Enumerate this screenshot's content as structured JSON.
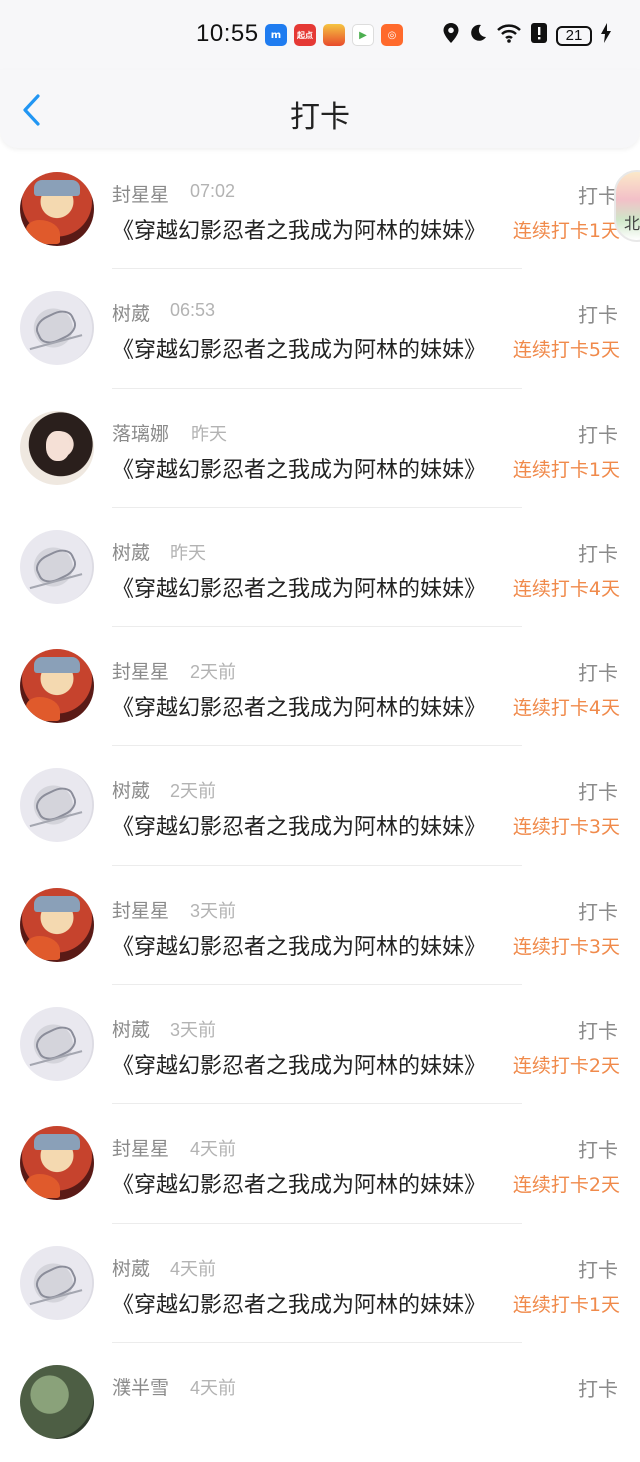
{
  "status_bar": {
    "time": "10:55",
    "apps": [
      {
        "label": "m",
        "color": "#1f7cf0"
      },
      {
        "label": "起点",
        "color": "#e53935"
      },
      {
        "label": "",
        "color": "#f29a1f"
      },
      {
        "label": "",
        "color": "#4caf50"
      },
      {
        "label": "",
        "color": "#ff6a2c"
      }
    ],
    "battery": "21"
  },
  "header": {
    "title": "打卡"
  },
  "edge_badge": {
    "text": "北"
  },
  "list": [
    {
      "name": "封星星",
      "time": "07:02",
      "tag": "打卡",
      "book": "《穿越幻影忍者之我成为阿林的妹妹》",
      "streak": "连续打卡1天",
      "avatar": "naruto"
    },
    {
      "name": "树葳",
      "time": "06:53",
      "tag": "打卡",
      "book": "《穿越幻影忍者之我成为阿林的妹妹》",
      "streak": "连续打卡5天",
      "avatar": "sketch"
    },
    {
      "name": "落璃娜",
      "time": "昨天",
      "tag": "打卡",
      "book": "《穿越幻影忍者之我成为阿林的妹妹》",
      "streak": "连续打卡1天",
      "avatar": "girl"
    },
    {
      "name": "树葳",
      "time": "昨天",
      "tag": "打卡",
      "book": "《穿越幻影忍者之我成为阿林的妹妹》",
      "streak": "连续打卡4天",
      "avatar": "sketch"
    },
    {
      "name": "封星星",
      "time": "2天前",
      "tag": "打卡",
      "book": "《穿越幻影忍者之我成为阿林的妹妹》",
      "streak": "连续打卡4天",
      "avatar": "naruto"
    },
    {
      "name": "树葳",
      "time": "2天前",
      "tag": "打卡",
      "book": "《穿越幻影忍者之我成为阿林的妹妹》",
      "streak": "连续打卡3天",
      "avatar": "sketch"
    },
    {
      "name": "封星星",
      "time": "3天前",
      "tag": "打卡",
      "book": "《穿越幻影忍者之我成为阿林的妹妹》",
      "streak": "连续打卡3天",
      "avatar": "naruto"
    },
    {
      "name": "树葳",
      "time": "3天前",
      "tag": "打卡",
      "book": "《穿越幻影忍者之我成为阿林的妹妹》",
      "streak": "连续打卡2天",
      "avatar": "sketch"
    },
    {
      "name": "封星星",
      "time": "4天前",
      "tag": "打卡",
      "book": "《穿越幻影忍者之我成为阿林的妹妹》",
      "streak": "连续打卡2天",
      "avatar": "naruto"
    },
    {
      "name": "树葳",
      "time": "4天前",
      "tag": "打卡",
      "book": "《穿越幻影忍者之我成为阿林的妹妹》",
      "streak": "连续打卡1天",
      "avatar": "sketch"
    },
    {
      "name": "濮半雪",
      "time": "4天前",
      "tag": "打卡",
      "book": "",
      "streak": "",
      "avatar": "green"
    }
  ]
}
